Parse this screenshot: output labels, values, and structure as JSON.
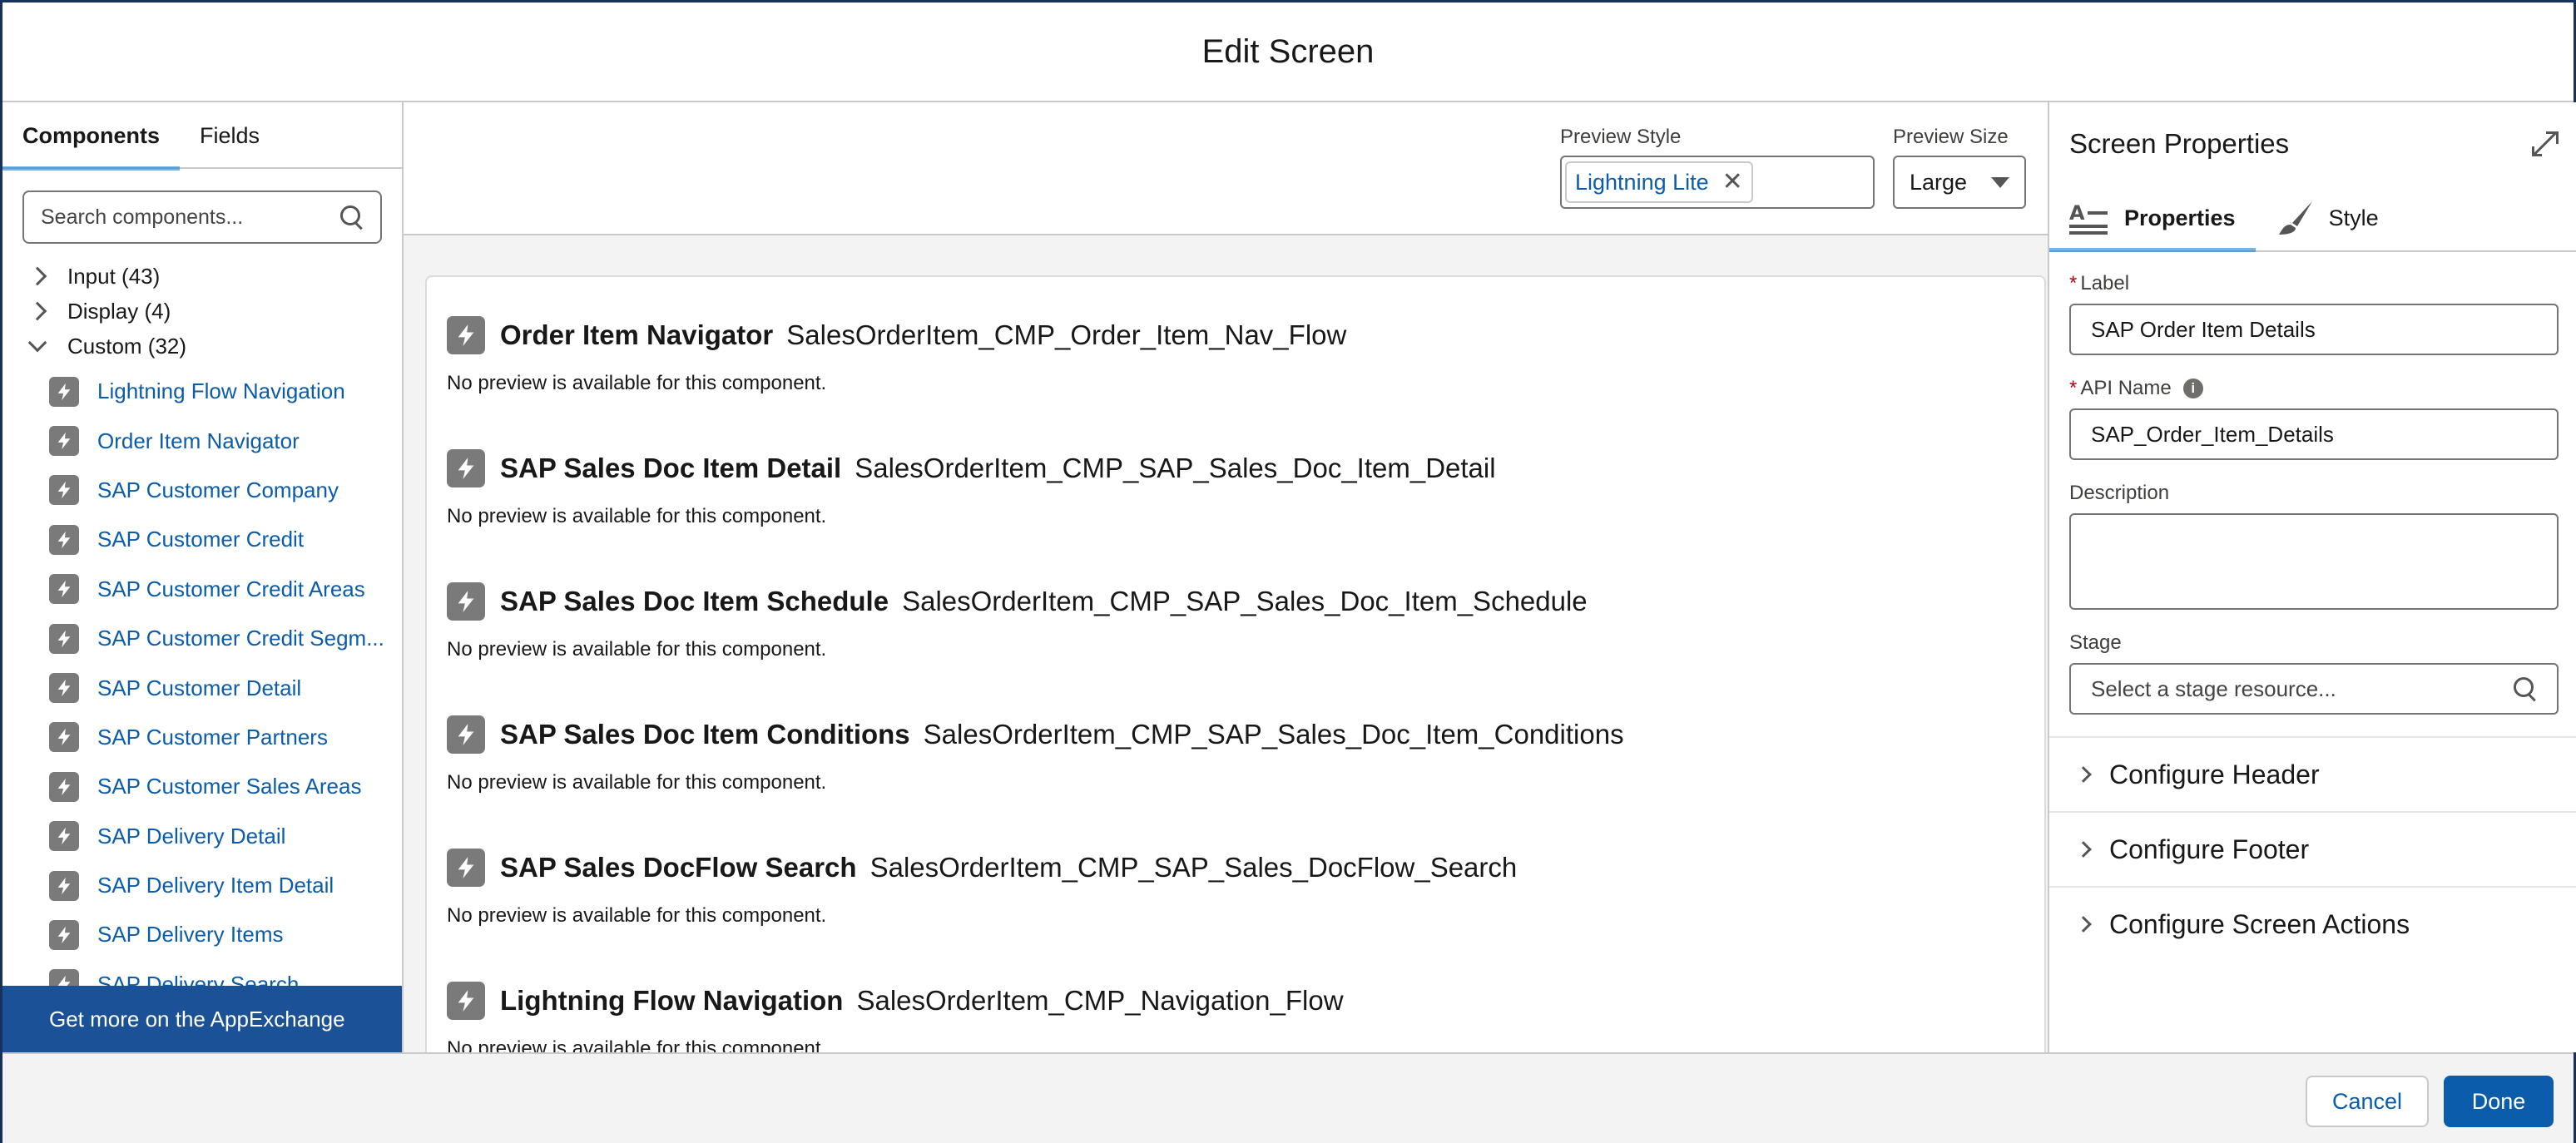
{
  "modal": {
    "title": "Edit Screen"
  },
  "left": {
    "tabs": [
      {
        "label": "Components"
      },
      {
        "label": "Fields"
      }
    ],
    "search_placeholder": "Search components...",
    "groups": [
      {
        "label": "Input (43)"
      },
      {
        "label": "Display (4)"
      },
      {
        "label": "Custom (32)"
      }
    ],
    "components": [
      {
        "label": "Lightning Flow Navigation"
      },
      {
        "label": "Order Item Navigator"
      },
      {
        "label": "SAP Customer Company"
      },
      {
        "label": "SAP Customer Credit"
      },
      {
        "label": "SAP Customer Credit Areas"
      },
      {
        "label": "SAP Customer Credit Segm..."
      },
      {
        "label": "SAP Customer Detail"
      },
      {
        "label": "SAP Customer Partners"
      },
      {
        "label": "SAP Customer Sales Areas"
      },
      {
        "label": "SAP Delivery Detail"
      },
      {
        "label": "SAP Delivery Item Detail"
      },
      {
        "label": "SAP Delivery Items"
      },
      {
        "label": "SAP Delivery Search"
      }
    ],
    "appexchange_label": "Get more on the AppExchange"
  },
  "toolbar": {
    "preview_style_label": "Preview Style",
    "preview_style_value": "Lightning Lite",
    "preview_size_label": "Preview Size",
    "preview_size_value": "Large"
  },
  "canvas": {
    "items": [
      {
        "title": "Order Item Navigator",
        "api": "SalesOrderItem_CMP_Order_Item_Nav_Flow",
        "note": "No preview is available for this component."
      },
      {
        "title": "SAP Sales Doc Item Detail",
        "api": "SalesOrderItem_CMP_SAP_Sales_Doc_Item_Detail",
        "note": "No preview is available for this component."
      },
      {
        "title": "SAP Sales Doc Item Schedule",
        "api": "SalesOrderItem_CMP_SAP_Sales_Doc_Item_Schedule",
        "note": "No preview is available for this component."
      },
      {
        "title": "SAP Sales Doc Item Conditions",
        "api": "SalesOrderItem_CMP_SAP_Sales_Doc_Item_Conditions",
        "note": "No preview is available for this component."
      },
      {
        "title": "SAP Sales DocFlow Search",
        "api": "SalesOrderItem_CMP_SAP_Sales_DocFlow_Search",
        "note": "No preview is available for this component."
      },
      {
        "title": "Lightning Flow Navigation",
        "api": "SalesOrderItem_CMP_Navigation_Flow",
        "note": "No preview is available for this component."
      }
    ]
  },
  "right": {
    "title": "Screen Properties",
    "tabs": [
      {
        "label": "Properties"
      },
      {
        "label": "Style"
      }
    ],
    "label_field": {
      "label": "Label",
      "value": "SAP Order Item Details"
    },
    "api_field": {
      "label": "API Name",
      "value": "SAP_Order_Item_Details"
    },
    "description_field": {
      "label": "Description",
      "value": ""
    },
    "stage_field": {
      "label": "Stage",
      "placeholder": "Select a stage resource..."
    },
    "sections": [
      {
        "label": "Configure Header"
      },
      {
        "label": "Configure Footer"
      },
      {
        "label": "Configure Screen Actions"
      }
    ]
  },
  "footer": {
    "cancel_label": "Cancel",
    "done_label": "Done"
  },
  "colors": {
    "brand": "#0b5cab",
    "appexchange": "#1b5297",
    "icon_gray": "#7a7a7a"
  }
}
